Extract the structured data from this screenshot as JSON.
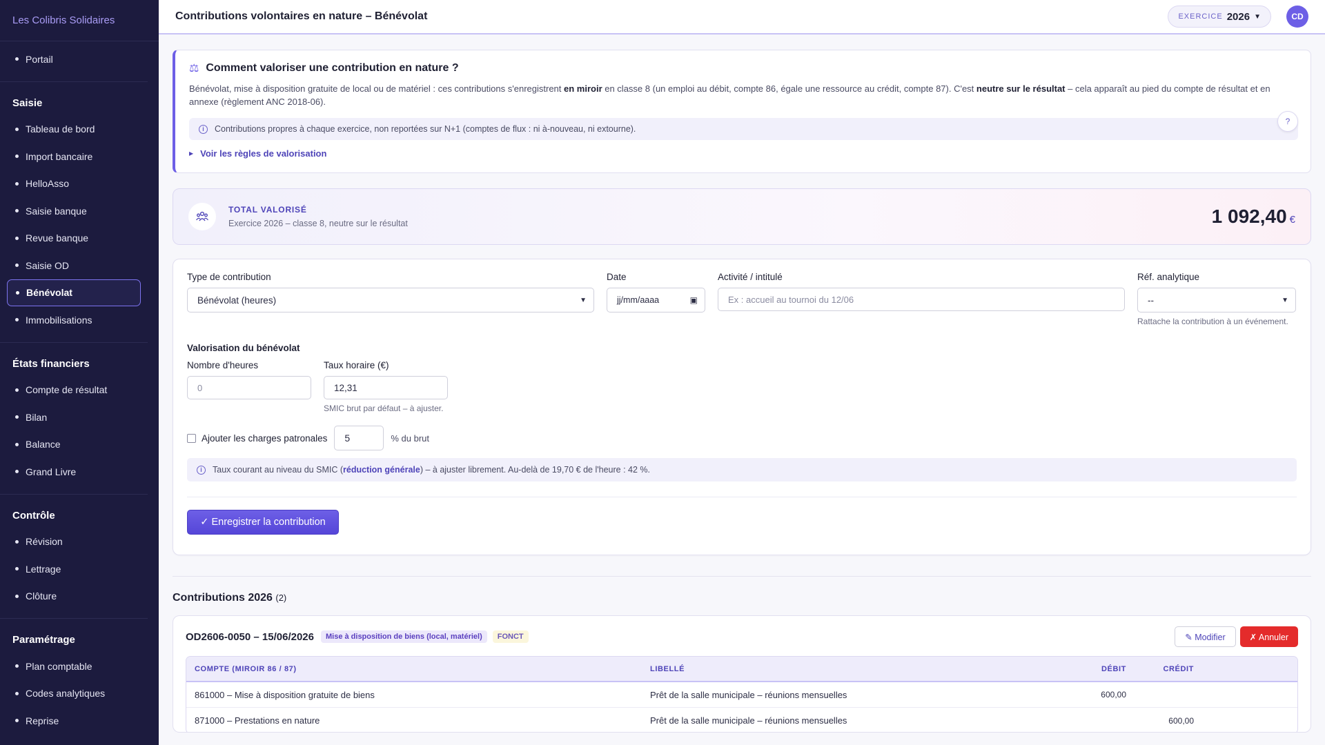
{
  "brand": "Les Colibris Solidaires",
  "nav": {
    "top": [
      {
        "label": "Portail"
      }
    ],
    "groups": [
      {
        "title": "Saisie",
        "items": [
          {
            "label": "Tableau de bord"
          },
          {
            "label": "Import bancaire"
          },
          {
            "label": "HelloAsso"
          },
          {
            "label": "Saisie banque"
          },
          {
            "label": "Revue banque"
          },
          {
            "label": "Saisie OD"
          },
          {
            "label": "Bénévolat",
            "active": true
          },
          {
            "label": "Immobilisations"
          }
        ]
      },
      {
        "title": "États financiers",
        "items": [
          {
            "label": "Compte de résultat"
          },
          {
            "label": "Bilan"
          },
          {
            "label": "Balance"
          },
          {
            "label": "Grand Livre"
          }
        ]
      },
      {
        "title": "Contrôle",
        "items": [
          {
            "label": "Révision"
          },
          {
            "label": "Lettrage"
          },
          {
            "label": "Clôture"
          }
        ]
      },
      {
        "title": "Paramétrage",
        "items": [
          {
            "label": "Plan comptable"
          },
          {
            "label": "Codes analytiques"
          },
          {
            "label": "Reprise"
          }
        ]
      }
    ]
  },
  "topbar": {
    "title": "Contributions volontaires en nature – Bénévolat",
    "exercice_label": "EXERCICE",
    "exercice_value": "2026",
    "avatar": "CD"
  },
  "info": {
    "title": "Comment valoriser une contribution en nature ?",
    "text_1": "Bénévolat, mise à disposition gratuite de local ou de matériel : ces contributions s'enregistrent ",
    "text_bold_1": "en miroir",
    "text_2": " en classe 8 (un emploi au débit, compte 86, égale une ressource au crédit, compte 87). C'est ",
    "text_bold_2": "neutre sur le résultat",
    "text_3": " – cela apparaît au pied du compte de résultat et en annexe (règlement ANC 2018-06).",
    "notice": "Contributions propres à chaque exercice, non reportées sur N+1 (comptes de flux : ni à-nouveau, ni extourne).",
    "help": "?",
    "rules_link": "Voir les règles de valorisation"
  },
  "total": {
    "label": "TOTAL VALORISÉ",
    "sub": "Exercice 2026 – classe 8, neutre sur le résultat",
    "amount": "1 092,40",
    "currency": "€"
  },
  "form": {
    "type_label": "Type de contribution",
    "type_value": "Bénévolat (heures)",
    "date_label": "Date",
    "date_placeholder": "jj/mm/aaaa",
    "activity_label": "Activité / intitulé",
    "activity_placeholder": "Ex : accueil au tournoi du 12/06",
    "ref_label": "Réf. analytique",
    "ref_value": "--",
    "ref_hint": "Rattache la contribution à un événement.",
    "valorisation_title": "Valorisation du bénévolat",
    "hours_label": "Nombre d'heures",
    "hours_placeholder": "0",
    "rate_label": "Taux horaire (€)",
    "rate_value": "12,31",
    "rate_hint": "SMIC brut par défaut – à ajuster.",
    "charges_label": "Ajouter les charges patronales",
    "charges_value": "5",
    "charges_unit": "% du brut",
    "notice_1": "Taux courant au niveau du SMIC (",
    "notice_bold": "réduction générale",
    "notice_2": ") – à ajuster librement. Au-delà de 19,70 € de l'heure : 42 %.",
    "submit": "✓ Enregistrer la contribution"
  },
  "list": {
    "title": "Contributions 2026",
    "count": "(2)",
    "entries": [
      {
        "title": "OD2606-0050 – 15/06/2026",
        "tag1": "Mise à disposition de biens (local, matériel)",
        "tag2": "FONCT",
        "modify": "✎ Modifier",
        "cancel": "✗ Annuler",
        "headers": {
          "account": "COMPTE (MIROIR 86 / 87)",
          "label": "LIBELLÉ",
          "debit": "DÉBIT",
          "credit": "CRÉDIT"
        },
        "rows": [
          {
            "account": "861000 – Mise à disposition gratuite de biens",
            "label": "Prêt de la salle municipale – réunions mensuelles",
            "debit": "600,00",
            "credit": ""
          },
          {
            "account": "871000 – Prestations en nature",
            "label": "Prêt de la salle municipale – réunions mensuelles",
            "debit": "",
            "credit": "600,00"
          }
        ]
      }
    ]
  }
}
